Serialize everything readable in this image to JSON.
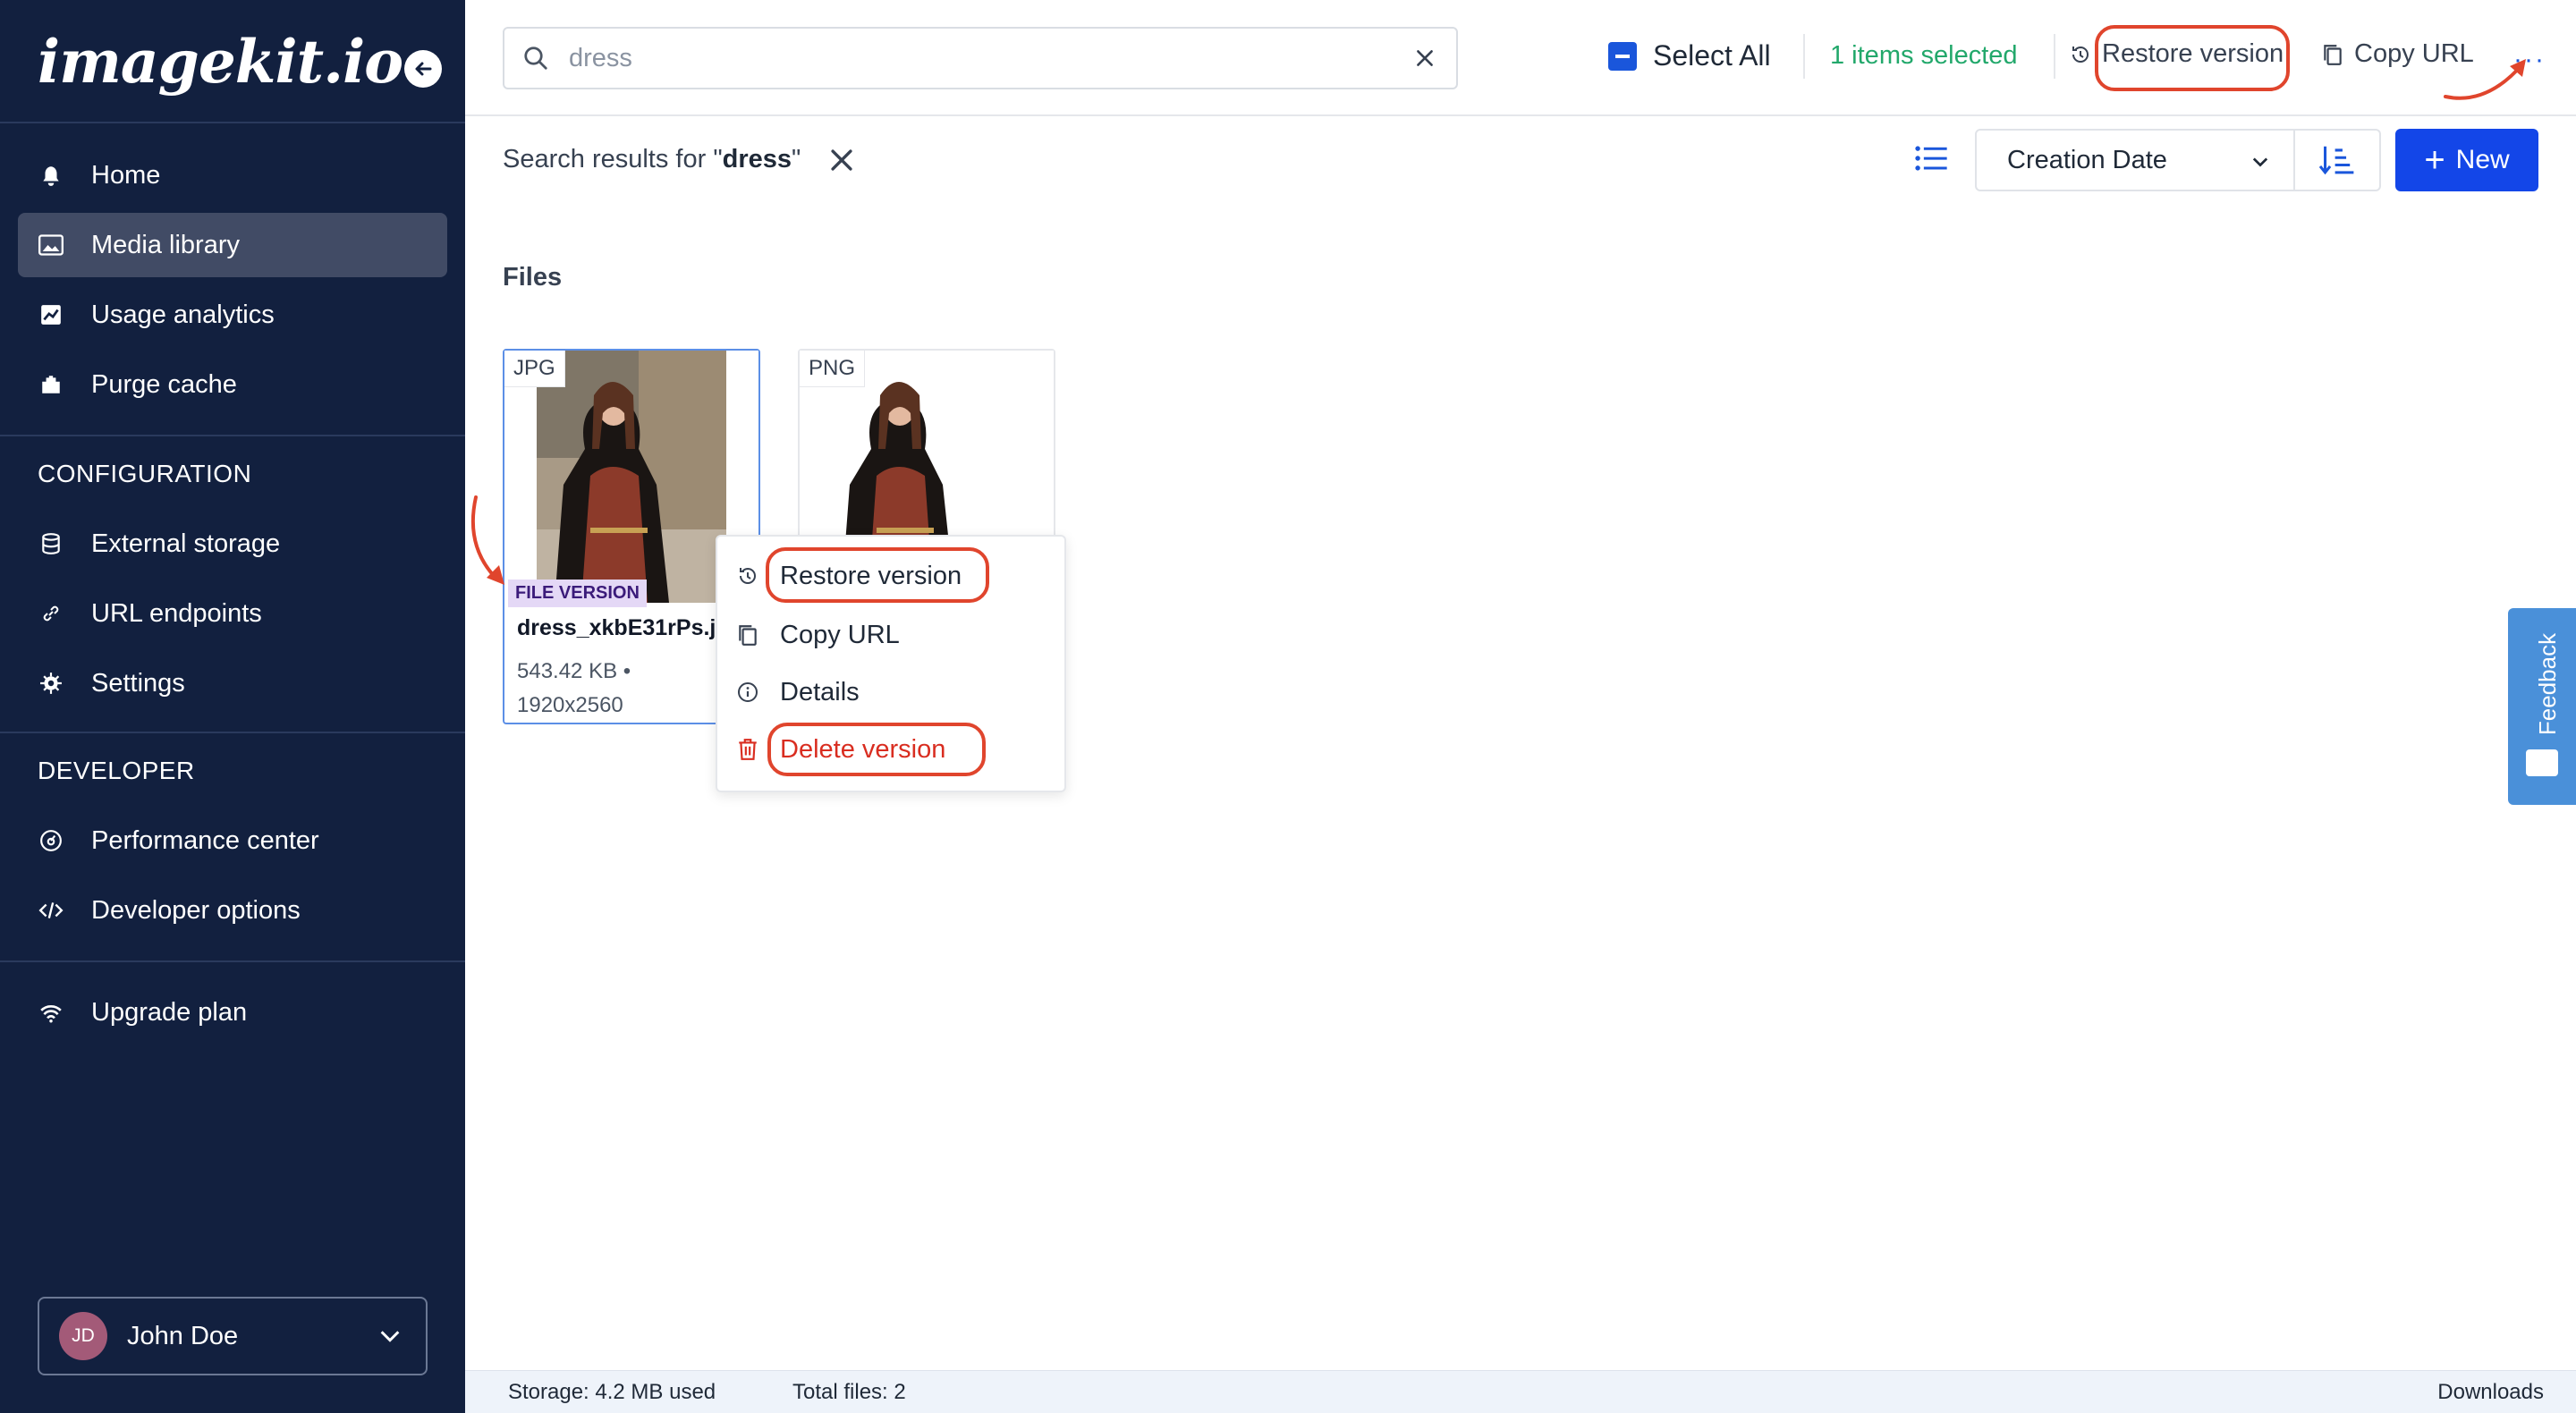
{
  "brand": {
    "logo_text": "imagekit.io"
  },
  "sidebar": {
    "nav": [
      {
        "label": "Home",
        "icon": "home-icon"
      },
      {
        "label": "Media library",
        "icon": "media-library-icon",
        "active": true
      },
      {
        "label": "Usage analytics",
        "icon": "analytics-icon"
      },
      {
        "label": "Purge cache",
        "icon": "purge-cache-icon"
      }
    ],
    "configuration_label": "CONFIGURATION",
    "configuration": [
      {
        "label": "External storage",
        "icon": "database-icon"
      },
      {
        "label": "URL endpoints",
        "icon": "link-icon"
      },
      {
        "label": "Settings",
        "icon": "gear-icon"
      }
    ],
    "developer_label": "DEVELOPER",
    "developer": [
      {
        "label": "Performance center",
        "icon": "performance-icon"
      },
      {
        "label": "Developer options",
        "icon": "code-icon"
      }
    ],
    "upgrade": {
      "label": "Upgrade plan",
      "icon": "upgrade-icon"
    },
    "user": {
      "initials": "JD",
      "name": "John Doe"
    }
  },
  "topbar": {
    "search_value": "dress",
    "select_all_label": "Select All",
    "items_selected": "1 items selected",
    "restore_version_label": "Restore version",
    "copy_url_label": "Copy URL",
    "more_label": "···"
  },
  "toolbar": {
    "results_prefix": "Search results for \"",
    "results_query": "dress",
    "results_suffix": "\"",
    "sort_label": "Creation Date",
    "new_label": "New"
  },
  "files_heading": "Files",
  "files": [
    {
      "type": "JPG",
      "badge": "FILE VERSION",
      "name": "dress_xkbE31rPs.j",
      "size": "543.42 KB •",
      "dimensions": "1920x2560",
      "selected": true
    },
    {
      "type": "PNG"
    }
  ],
  "context_menu": {
    "items": [
      {
        "label": "Restore version",
        "icon": "restore-icon"
      },
      {
        "label": "Copy URL",
        "icon": "copy-icon"
      },
      {
        "label": "Details",
        "icon": "info-icon"
      },
      {
        "label": "Delete version",
        "icon": "trash-icon",
        "danger": true
      }
    ]
  },
  "feedback_label": "Feedback",
  "status": {
    "storage": "Storage: 4.2 MB used",
    "total_files": "Total files: 2",
    "downloads": "Downloads"
  },
  "colors": {
    "sidebar_bg": "#12203f",
    "accent": "#1346e8",
    "highlight": "#e0452d",
    "selected_text": "#22a86b",
    "danger": "#d92d20"
  }
}
